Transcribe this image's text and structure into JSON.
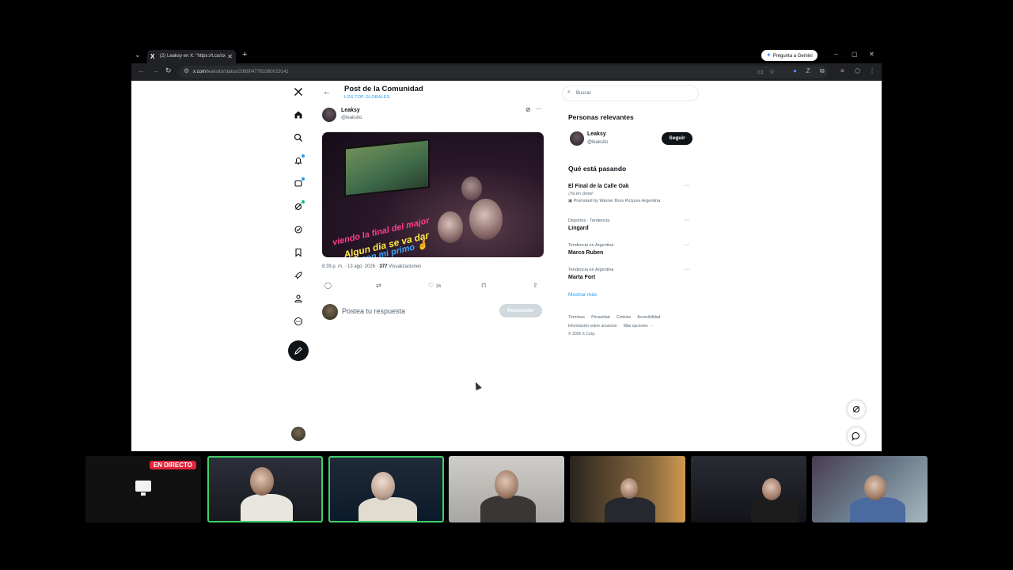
{
  "browser": {
    "tab_title": "(2) Leaksy en X: \"https://t.co/sx",
    "tab_close": "✕",
    "new_tab": "+",
    "gemini_label": "Pregunta a Gemini",
    "url_host": "x.com",
    "url_path": "/leaksito/status/2088047760380019141",
    "win_min": "–",
    "win_max": "▢",
    "win_close": "✕"
  },
  "post_header": {
    "title": "Post de la Comunidad",
    "subtitle": "LOS TOP GLOBALES"
  },
  "post": {
    "author_name": "Leaksy",
    "author_handle": "@leaksito",
    "image_text_line1": "viendo la final del major",
    "image_text_line2": "Algun dia se va dar",
    "image_text_line3": "con mi primo 🤞",
    "time": "8:39 p. m. · 13 ago. 2026 · ",
    "views_count": "377",
    "views_label": " Visualizaciones",
    "likes": "16"
  },
  "reply": {
    "placeholder": "Postea tu respuesta",
    "button": "Responder"
  },
  "sidebar": {
    "search_placeholder": "Buscar",
    "relevant_heading": "Personas relevantes",
    "relevant_person": {
      "name": "Leaksy",
      "handle": "@leaksito",
      "follow": "Seguir"
    },
    "trending_heading": "Qué está pasando",
    "trends": [
      {
        "top": "",
        "title": "El Final de la Calle Oak",
        "sub": "¡Ya en cines!",
        "promo": "Promoted by Warner Bros Pictures Argentina"
      },
      {
        "top": "Deportes · Tendencia",
        "title": "Lingard"
      },
      {
        "top": "Tendencia en Argentina",
        "title": "Marco Ruben"
      },
      {
        "top": "Tendencia en Argentina",
        "title": "Marta Fort"
      }
    ],
    "show_more": "Mostrar más",
    "footer_row1": [
      "Términos",
      "Privacidad",
      "Cookies",
      "Accesibilidad"
    ],
    "footer_row2": [
      "Información sobre anuncios",
      "Más opciones ···"
    ],
    "footer_copy": "© 2026 X Corp."
  },
  "stream": {
    "live_badge": "EN DIRECTO"
  },
  "colors": {
    "accent": "#1d9bf0",
    "live": "#e0243a",
    "active_cam_border": "#3fcf6a"
  }
}
